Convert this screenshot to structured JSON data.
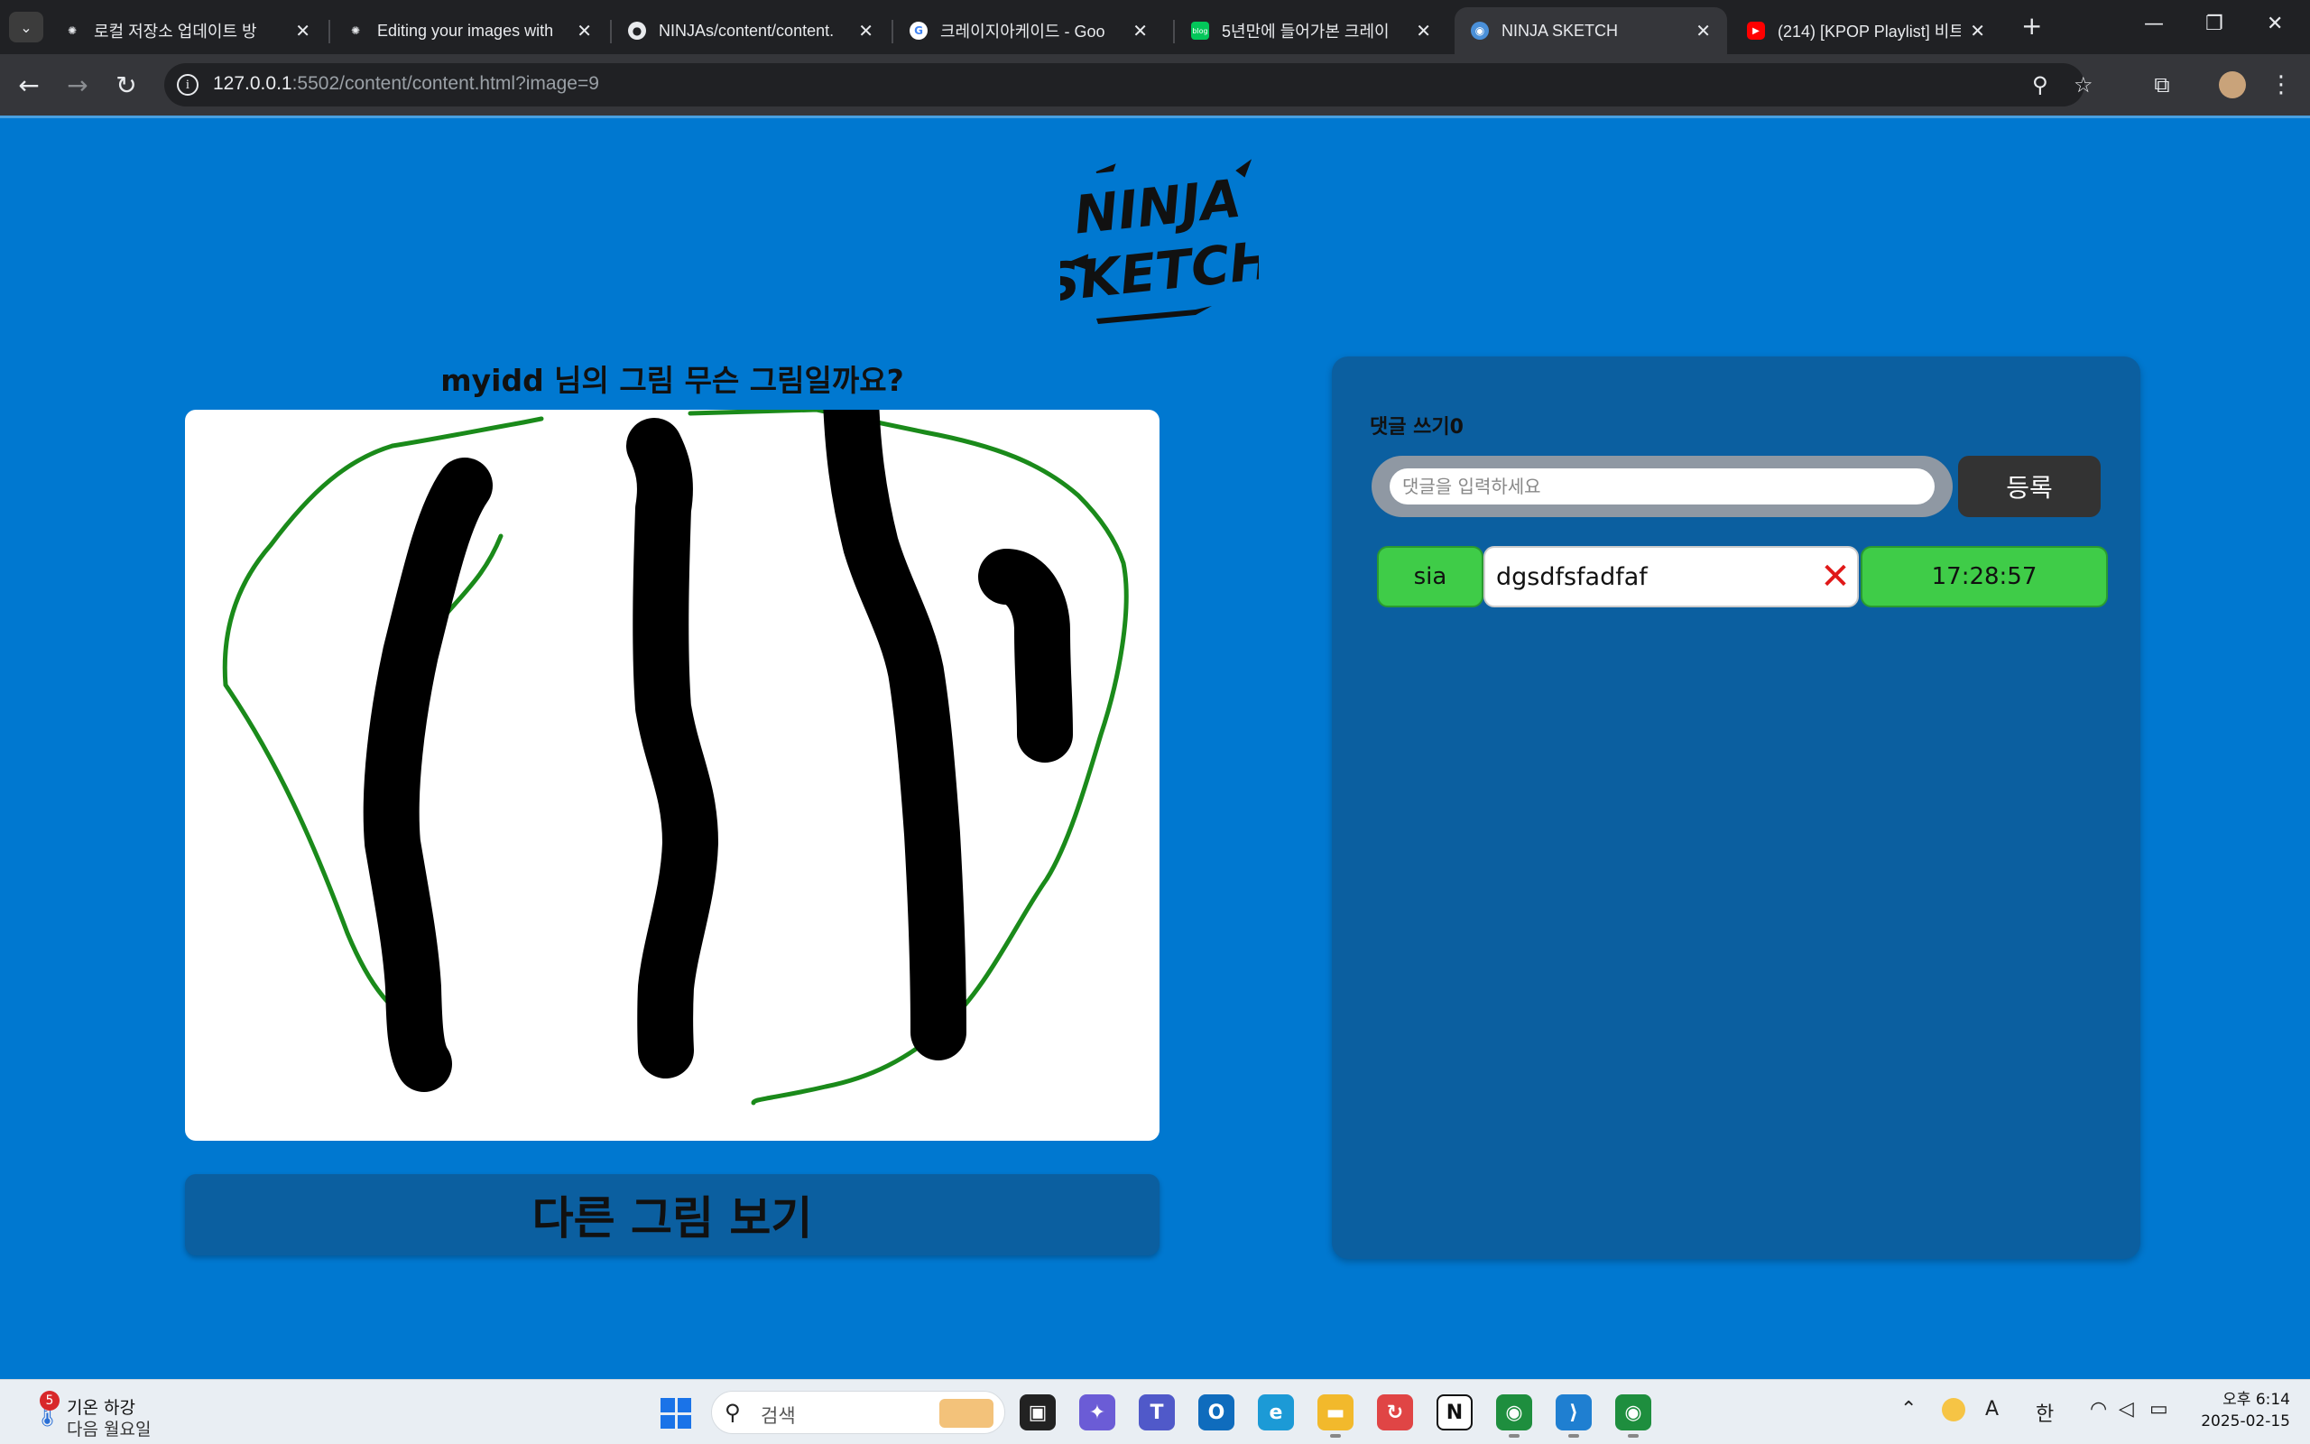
{
  "browser": {
    "tabs": [
      {
        "title": "로컬 저장소 업데이트 방",
        "favicon": "openai-icon",
        "active": false
      },
      {
        "title": "Editing your images with",
        "favicon": "openai-icon",
        "active": false
      },
      {
        "title": "NINJAs/content/content.",
        "favicon": "github-icon",
        "active": false
      },
      {
        "title": "크레이지아케이드 - Goo",
        "favicon": "google-icon",
        "active": false
      },
      {
        "title": "5년만에 들어가본 크레이",
        "favicon": "naver-blog-icon",
        "active": false
      },
      {
        "title": "NINJA SKETCH",
        "favicon": "globe-icon",
        "active": true
      },
      {
        "title": "(214) [KPOP Playlist] 비트",
        "favicon": "youtube-icon",
        "active": false
      }
    ],
    "url_host": "127.0.0.1",
    "url_rest": ":5502/content/content.html?image=9"
  },
  "page": {
    "prompt": "myidd 님의 그림 무슨 그림일까요?",
    "next_button": "다른 그림 보기",
    "logo_alt": "NINJA SKETCH"
  },
  "comments": {
    "title": "댓글 쓰기0",
    "input_placeholder": "댓글을 입력하세요",
    "input_value": "",
    "submit_label": "등록",
    "delete_icon": "×",
    "items": [
      {
        "author": "sia",
        "text": "dgsdfsfadfaf",
        "time": "17:28:57"
      }
    ]
  },
  "taskbar": {
    "weather_badge": "5",
    "weather_line1": "기온 하강",
    "weather_line2": "다음 월요일",
    "search_label": "검색",
    "ime_a": "A",
    "ime_lang": "한",
    "time": "오후 6:14",
    "date": "2025-02-15"
  },
  "colors": {
    "page_bg": "#0078d0",
    "panel_bg": "#0b5fa0",
    "green_chip": "#3fcc48",
    "delete_red": "#e01818",
    "sketch_green": "#1a8a1a",
    "sketch_black": "#000000"
  }
}
